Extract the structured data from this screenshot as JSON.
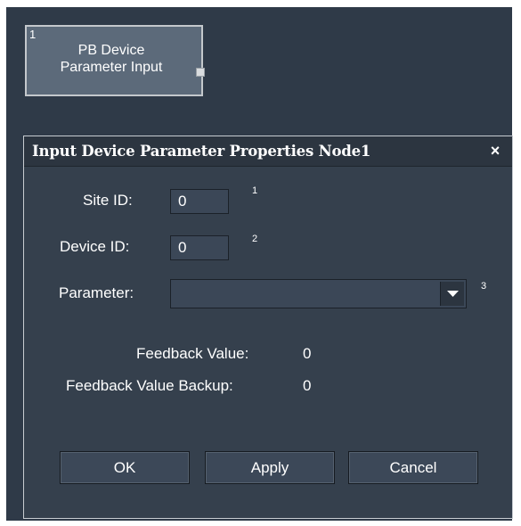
{
  "node": {
    "index": "1",
    "title": "PB Device\nParameter Input"
  },
  "dialog": {
    "title": "Input Device Parameter  Properties Node1",
    "close_label": "×",
    "site_id": {
      "label": "Site ID:",
      "value": "0",
      "marker": "1"
    },
    "device_id": {
      "label": "Device ID:",
      "value": "0",
      "marker": "2"
    },
    "parameter": {
      "label": "Parameter:",
      "value": "",
      "marker": "3"
    },
    "feedback_value": {
      "label": "Feedback Value:",
      "value": "0"
    },
    "feedback_value_backup": {
      "label": "Feedback Value Backup:",
      "value": "0"
    },
    "buttons": {
      "ok": "OK",
      "apply": "Apply",
      "cancel": "Cancel"
    }
  },
  "icons": {
    "close": "close-icon",
    "dropdown": "chevron-down-icon"
  },
  "colors": {
    "canvas_bg": "#2f3a48",
    "dialog_bg": "#35404d",
    "titlebar_bg": "#2c3540",
    "node_bg": "#5c6a7a",
    "input_bg": "#3b4757"
  }
}
